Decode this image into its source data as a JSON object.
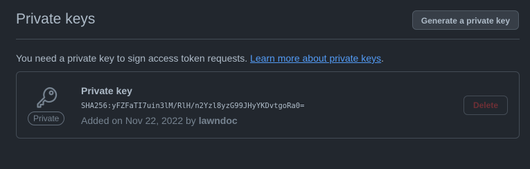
{
  "header": {
    "title": "Private keys",
    "generate_button": "Generate a private key"
  },
  "description": {
    "text": "You need a private key to sign access token requests. ",
    "link_text": "Learn more about private keys",
    "trailing": "."
  },
  "key": {
    "badge": "Private",
    "title": "Private key",
    "fingerprint": "SHA256:yFZFaTI7uin3lM/RlH/n2Yzl8yzG99JHyYKDvtgoRa0=",
    "added_prefix": "Added on Nov 22, 2022 by ",
    "added_by": "lawndoc",
    "delete_button": "Delete",
    "icon": "key-icon"
  },
  "colors": {
    "background": "#22272e",
    "link": "#539bf5",
    "delete_disabled": "#6e2f35"
  }
}
